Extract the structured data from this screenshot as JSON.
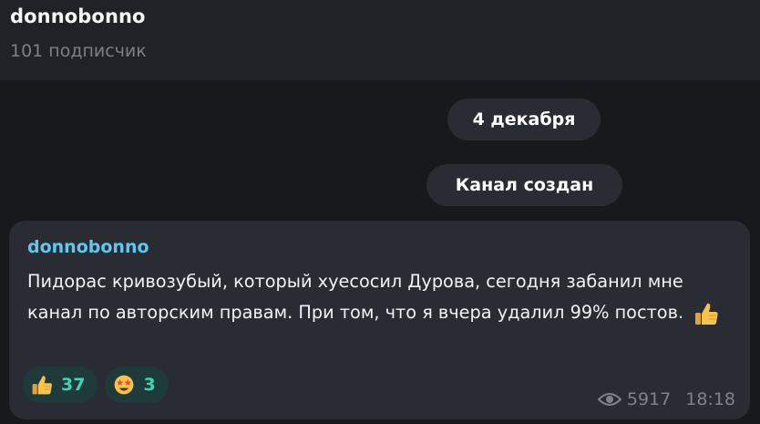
{
  "header": {
    "channel_name": "donnobonno",
    "subscribers": "101 подписчик"
  },
  "feed": {
    "date_pill": "4 декабря",
    "service_message": "Канал создан"
  },
  "post": {
    "author": "donnobonno",
    "text": "Пидорас кривозубый, который хуесосил Дурова, сегодня забанил мне канал по авторским правам. При том, что я вчера удалил 99% постов.",
    "text_emoji_icon": "thumbs-up-icon",
    "reactions": [
      {
        "icon": "thumbs-up-icon",
        "count": "37"
      },
      {
        "icon": "star-struck-icon",
        "count": "3"
      }
    ],
    "views": "5917",
    "time": "18:18"
  },
  "colors": {
    "header_bg": "#212227",
    "feed_bg": "#18191d",
    "bubble_bg": "#2a2c33",
    "author": "#5ec8f0",
    "reaction_bg": "#1f3a3b",
    "reaction_count": "#3dd6b5",
    "meta_text": "#7e828c"
  }
}
